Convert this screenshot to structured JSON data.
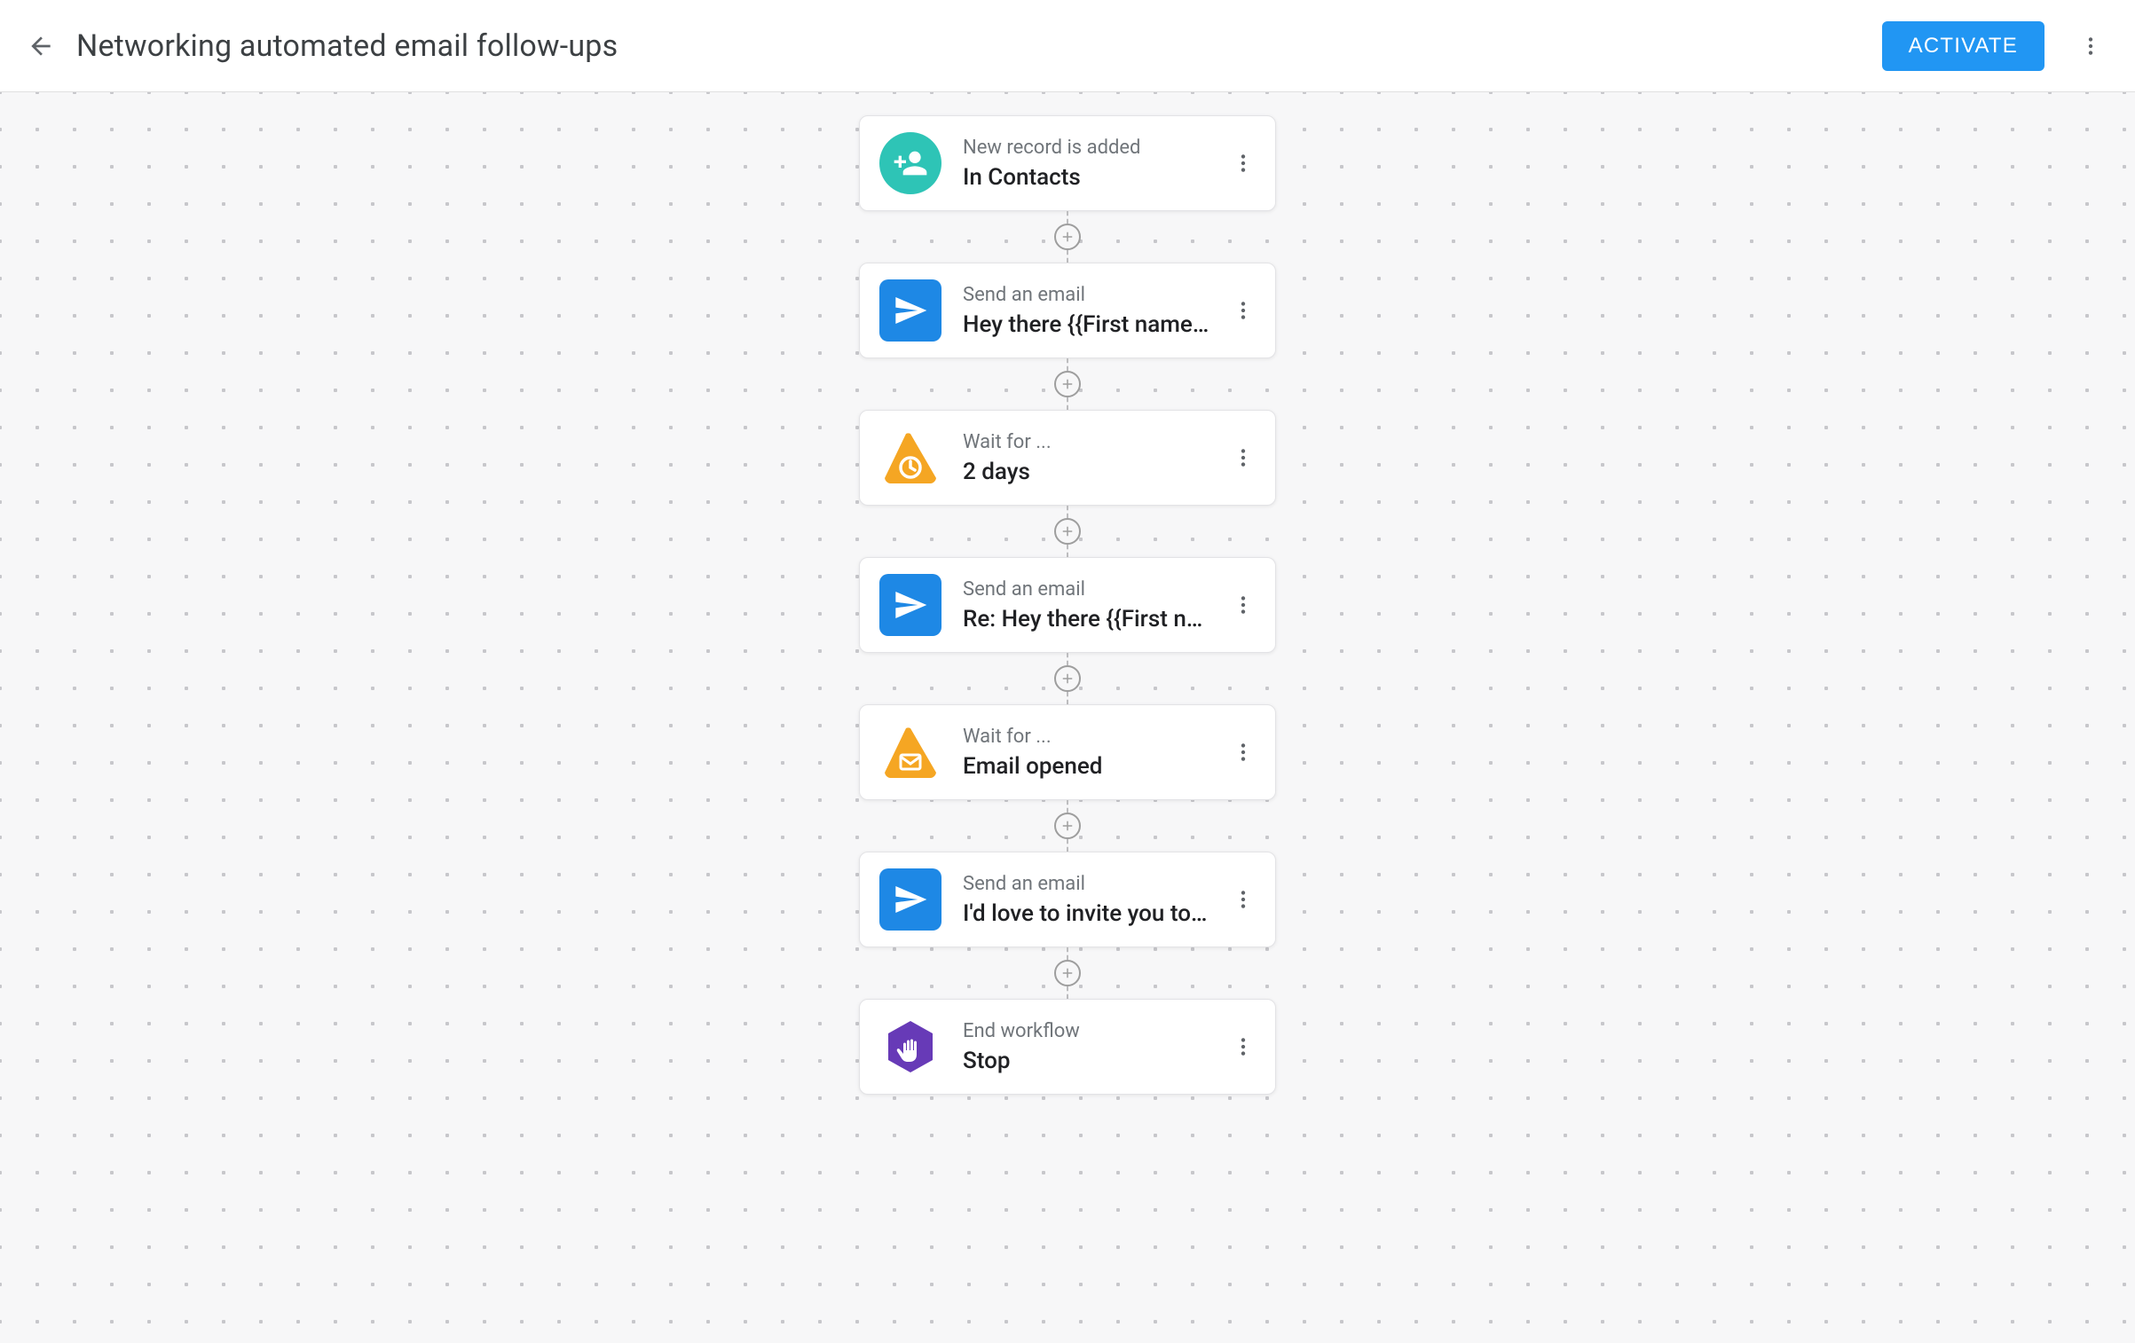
{
  "header": {
    "title": "Networking automated email follow-ups",
    "activate_label": "ACTIVATE"
  },
  "nodes": [
    {
      "icon": "person-add-teal",
      "label": "New record is added",
      "value": "In Contacts"
    },
    {
      "icon": "send-blue",
      "label": "Send an email",
      "value": "Hey there {{First name…"
    },
    {
      "icon": "wait-clock",
      "label": "Wait for ...",
      "value": "2 days"
    },
    {
      "icon": "send-blue",
      "label": "Send an email",
      "value": "Re: Hey there {{First n…"
    },
    {
      "icon": "wait-mail",
      "label": "Wait for ...",
      "value": "Email opened"
    },
    {
      "icon": "send-blue",
      "label": "Send an email",
      "value": "I'd love to invite you to…"
    },
    {
      "icon": "stop-purple",
      "label": "End workflow",
      "value": "Stop"
    }
  ]
}
